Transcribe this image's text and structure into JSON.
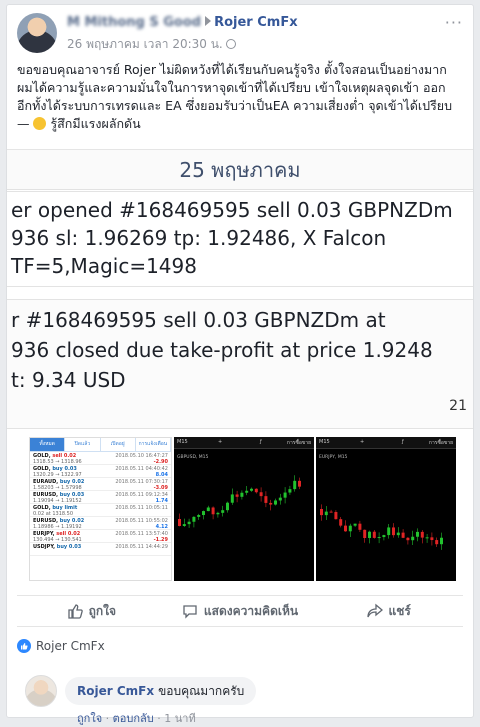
{
  "post": {
    "author_obscured": "M Mithong S Good",
    "page_name": "Rojer CmFx",
    "timestamp": "26 พฤษภาคม เวลา 20:30 น.",
    "body_text": "ขอขอบคุณอาจารย์ Rojer ไม่ผิดหวังที่ได้เรียนกับคนรู้จริง ตั้งใจสอนเป็นอย่างมาก ผมได้ความรู้และความมั่นใจในการหาจุดเข้าที่ได้เปรียบ เข้าใจเหตุผลจุดเข้า ออก อีกทั้งได้ระบบการเทรดและ EA ซึ่งยอมรับว่าเป็นEA ความเสี่ยงต่ำ จุดเข้าได้เปรียบ — ",
    "feeling_text": "รู้สึกมีแรงผลักดัน"
  },
  "notification": {
    "date_header": "25 พฤษภาคม",
    "opened_line1": "er opened #168469595 sell 0.03 GBPNZDm",
    "opened_line2": "936 sl: 1.96269 tp: 1.92486, X Falcon",
    "opened_line3": "TF=5,Magic=1498",
    "closed_line1": "r #168469595 sell 0.03 GBPNZDm at",
    "closed_line2": "936 closed due take-profit at price 1.9248",
    "closed_line3": "t: 9.34 USD",
    "closed_time_partial": "21"
  },
  "trade_list": {
    "tabs": [
      "ทั้งหมด",
      "ปิดแล้ว",
      "เปิดอยู่",
      "การแจ้งเตือน"
    ],
    "active_tab": 0,
    "rows": [
      {
        "symbol": "GOLD",
        "type": "sell 0.02",
        "prices": "1318.53 → 1318.96",
        "date": "2018.05.10 16:47:27",
        "pl": "-2.90"
      },
      {
        "symbol": "GOLD",
        "type": "buy 0.03",
        "prices": "1320.29 → 1322.97",
        "date": "2018.05.11 04:40:42",
        "pl": "8.04"
      },
      {
        "symbol": "EURAUD",
        "type": "buy 0.02",
        "prices": "1.58203 → 1.57998",
        "date": "2018.05.11 07:30:17",
        "pl": "-3.09"
      },
      {
        "symbol": "EURUSD",
        "type": "buy 0.03",
        "prices": "1.19094 → 1.19152",
        "date": "2018.05.11 09:12:34",
        "pl": "1.74"
      },
      {
        "symbol": "GOLD",
        "type": "buy limit",
        "prices": "0.02 at 1318.50",
        "date": "2018.05.11 10:05:11",
        "pl": ""
      },
      {
        "symbol": "EURUSD",
        "type": "buy 0.02",
        "prices": "1.18986 → 1.19192",
        "date": "2018.05.11 10:55:02",
        "pl": "4.12"
      },
      {
        "symbol": "EURJPY",
        "type": "sell 0.02",
        "prices": "130.494 → 130.541",
        "date": "2018.05.11 13:57:40",
        "pl": "-1.29"
      },
      {
        "symbol": "USDJPY",
        "type": "buy 0.03",
        "prices": "",
        "date": "2018.05.11 14:44:29",
        "pl": ""
      }
    ]
  },
  "charts": [
    {
      "timeframe": "M15",
      "label": "การซื้อขาย",
      "symbol": "GBPUSD, M15"
    },
    {
      "timeframe": "M15",
      "label": "การซื้อขาย",
      "symbol": "EURJPY, M15"
    }
  ],
  "actions": {
    "like": "ถูกใจ",
    "comment": "แสดงความคิดเห็น",
    "share": "แชร์"
  },
  "likes_summary": "Rojer CmFx",
  "comment": {
    "author": "Rojer CmFx",
    "text": "ขอบคุณมากครับ",
    "like": "ถูกใจ",
    "reply": "ตอบกลับ",
    "time": "1 นาที"
  },
  "colors": {
    "link": "#365899",
    "like_blue": "#2d88ff",
    "chart_bg": "#000000",
    "candle_up": "#22c22e",
    "candle_down": "#e02424"
  }
}
